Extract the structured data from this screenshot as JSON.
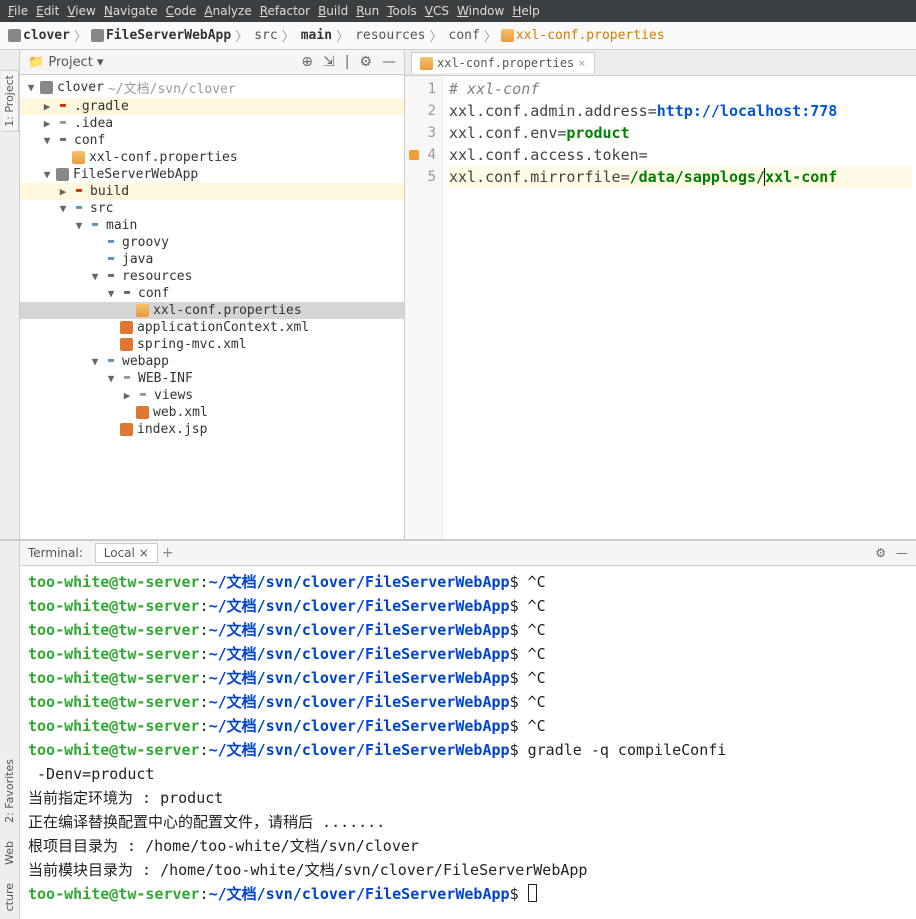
{
  "menu": [
    "File",
    "Edit",
    "View",
    "Navigate",
    "Code",
    "Analyze",
    "Refactor",
    "Build",
    "Run",
    "Tools",
    "VCS",
    "Window",
    "Help"
  ],
  "breadcrumbs": [
    {
      "name": "clover",
      "icon": "module",
      "bold": true
    },
    {
      "name": "FileServerWebApp",
      "icon": "module",
      "bold": true
    },
    {
      "name": "src",
      "icon": "folder"
    },
    {
      "name": "main",
      "icon": "folder",
      "bold": true
    },
    {
      "name": "resources",
      "icon": "folder"
    },
    {
      "name": "conf",
      "icon": "folder"
    },
    {
      "name": "xxl-conf.properties",
      "icon": "prop",
      "orange": true
    }
  ],
  "sidebar": {
    "title": "Project",
    "left_tabs": [
      "1: Project"
    ],
    "bottom_tabs": [
      "2: Favorites",
      "Web",
      "cture"
    ],
    "root": {
      "name": "clover",
      "path": "~/文档/svn/clover"
    },
    "tree": [
      {
        "indent": 0,
        "arrow": "▼",
        "icon": "module",
        "name": "clover",
        "suffix": "~/文档/svn/clover"
      },
      {
        "indent": 1,
        "arrow": "▶",
        "icon": "folder-red",
        "name": ".gradle",
        "highlighted": true
      },
      {
        "indent": 1,
        "arrow": "▶",
        "icon": "folder-grey",
        "name": ".idea"
      },
      {
        "indent": 1,
        "arrow": "▼",
        "icon": "folder",
        "name": "conf"
      },
      {
        "indent": 2,
        "arrow": "",
        "icon": "prop",
        "name": "xxl-conf.properties"
      },
      {
        "indent": 1,
        "arrow": "▼",
        "icon": "module",
        "name": "FileServerWebApp"
      },
      {
        "indent": 2,
        "arrow": "▶",
        "icon": "folder-red",
        "name": "build",
        "highlighted": true
      },
      {
        "indent": 2,
        "arrow": "▼",
        "icon": "folder-blue",
        "name": "src"
      },
      {
        "indent": 3,
        "arrow": "▼",
        "icon": "folder-blue",
        "name": "main"
      },
      {
        "indent": 4,
        "arrow": "",
        "icon": "folder-blue",
        "name": "groovy"
      },
      {
        "indent": 4,
        "arrow": "",
        "icon": "folder-blue",
        "name": "java"
      },
      {
        "indent": 4,
        "arrow": "▼",
        "icon": "folder",
        "name": "resources"
      },
      {
        "indent": 5,
        "arrow": "▼",
        "icon": "folder",
        "name": "conf"
      },
      {
        "indent": 6,
        "arrow": "",
        "icon": "prop",
        "name": "xxl-conf.properties",
        "selected": true
      },
      {
        "indent": 5,
        "arrow": "",
        "icon": "xml",
        "name": "applicationContext.xml"
      },
      {
        "indent": 5,
        "arrow": "",
        "icon": "xml",
        "name": "spring-mvc.xml"
      },
      {
        "indent": 4,
        "arrow": "▼",
        "icon": "folder-blue",
        "name": "webapp"
      },
      {
        "indent": 5,
        "arrow": "▼",
        "icon": "folder-grey",
        "name": "WEB-INF"
      },
      {
        "indent": 6,
        "arrow": "▶",
        "icon": "folder-grey",
        "name": "views"
      },
      {
        "indent": 6,
        "arrow": "",
        "icon": "xml",
        "name": "web.xml"
      },
      {
        "indent": 5,
        "arrow": "",
        "icon": "xml",
        "name": "index.jsp"
      }
    ]
  },
  "editor": {
    "tab": "xxl-conf.properties",
    "lines": [
      {
        "n": 1,
        "segments": [
          {
            "cls": "comment",
            "t": "# xxl-conf"
          }
        ]
      },
      {
        "n": 2,
        "segments": [
          {
            "cls": "key",
            "t": "xxl.conf.admin.address"
          },
          {
            "cls": "eq",
            "t": "="
          },
          {
            "cls": "val-blue",
            "t": "http://localhost:778"
          }
        ]
      },
      {
        "n": 3,
        "segments": [
          {
            "cls": "key",
            "t": "xxl.conf.env"
          },
          {
            "cls": "eq",
            "t": "="
          },
          {
            "cls": "val-green",
            "t": "product"
          }
        ]
      },
      {
        "n": 4,
        "segments": [
          {
            "cls": "key",
            "t": "xxl.conf.access.token"
          },
          {
            "cls": "eq",
            "t": "="
          }
        ],
        "hint": true
      },
      {
        "n": 5,
        "segments": [
          {
            "cls": "key",
            "t": "xxl.conf.mirrorfile"
          },
          {
            "cls": "eq",
            "t": "="
          },
          {
            "cls": "val-dgreen",
            "t": "/data/sapplogs/"
          },
          {
            "cls": "caret",
            "t": ""
          },
          {
            "cls": "val-dgreen",
            "t": "xxl-conf"
          }
        ],
        "active": true
      }
    ]
  },
  "terminal": {
    "label": "Terminal:",
    "tab": "Local",
    "prompt_parts": {
      "user": "too-white@tw-server",
      "sep": ":",
      "path": "~/文档/svn/clover/FileServerWebApp",
      "sym": "$"
    },
    "history": [
      {
        "cmd": "^C"
      },
      {
        "cmd": "^C"
      },
      {
        "cmd": "^C"
      },
      {
        "cmd": "^C"
      },
      {
        "cmd": "^C"
      },
      {
        "cmd": "^C"
      },
      {
        "cmd": "^C"
      },
      {
        "cmd": "gradle -q compileConfi"
      }
    ],
    "wrap_line": " -Denv=product",
    "output": [
      "当前指定环境为 : product",
      "正在编译替换配置中心的配置文件，请稍后 .......",
      "根项目目录为 : /home/too-white/文档/svn/clover",
      "当前模块目录为 : /home/too-white/文档/svn/clover/FileServerWebApp"
    ]
  }
}
